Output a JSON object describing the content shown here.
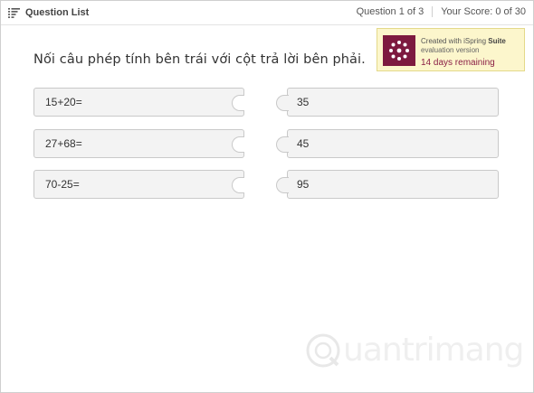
{
  "topbar": {
    "question_list_label": "Question List",
    "question_counter": "Question 1 of 3",
    "score": "Your Score: 0 of 30"
  },
  "banner": {
    "line1_prefix": "Created with iSpring ",
    "line1_bold": "Suite",
    "line2": "evaluation version",
    "line3": "14 days remaining"
  },
  "question": {
    "text": "Nối câu phép tính bên trái với cột trả lời bên phải."
  },
  "left_items": [
    {
      "label": "15+20="
    },
    {
      "label": "27+68="
    },
    {
      "label": "70-25="
    }
  ],
  "right_items": [
    {
      "label": "35"
    },
    {
      "label": "45"
    },
    {
      "label": "95"
    }
  ],
  "watermark": {
    "text": "uantrimang"
  },
  "colors": {
    "banner_logo": "#7d1a3f",
    "banner_bg": "#fcf6cc",
    "tile_bg": "#f3f3f3",
    "remaining_text": "#8a1e45"
  }
}
